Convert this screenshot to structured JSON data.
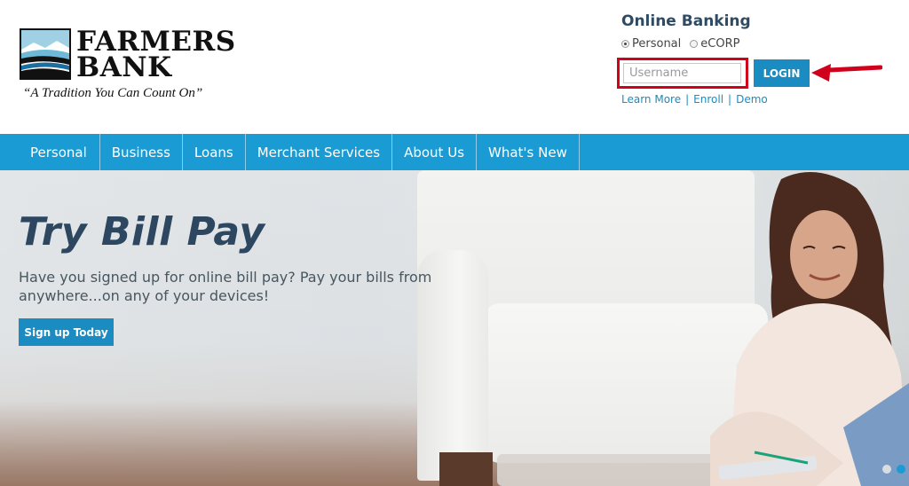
{
  "logo": {
    "word1": "FARMERS",
    "word2": "BANK",
    "tagline": "“A Tradition You Can Count On”"
  },
  "online_banking": {
    "title": "Online Banking",
    "radio_personal": "Personal",
    "radio_ecorp": "eCORP",
    "selected": "Personal",
    "username_placeholder": "Username",
    "username_value": "",
    "login_label": "LOGIN",
    "links": [
      "Learn More",
      "Enroll",
      "Demo"
    ],
    "link_separator": "|"
  },
  "nav": {
    "items": [
      "Personal",
      "Business",
      "Loans",
      "Merchant Services",
      "About Us",
      "What's New"
    ]
  },
  "hero": {
    "title": "Try Bill Pay",
    "text": "Have you signed up for online bill pay? Pay your bills from anywhere...on any of your devices!",
    "button": "Sign up Today",
    "slide_count": 2,
    "active_slide": 2
  },
  "colors": {
    "accent": "#1a9bd3",
    "button": "#1a8cc1",
    "title": "#2e4760",
    "highlight": "#d0021b"
  }
}
